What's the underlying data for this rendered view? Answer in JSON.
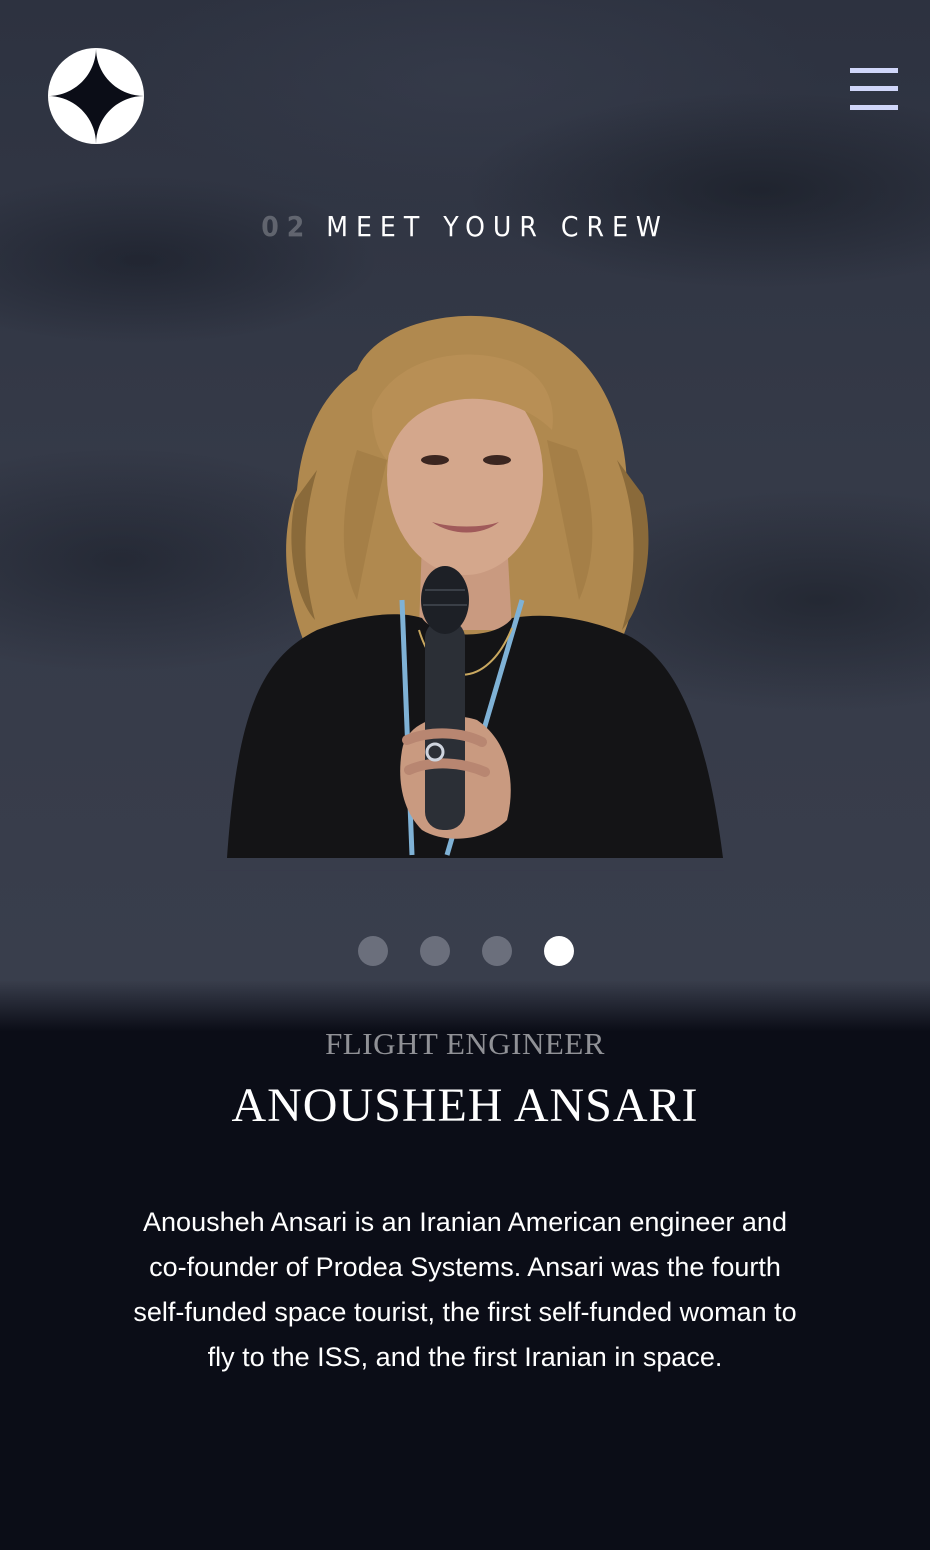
{
  "header": {
    "logo_icon": "four-point-star-icon",
    "menu_icon": "hamburger-menu-icon"
  },
  "page": {
    "number": "02",
    "title": "MEET YOUR CREW"
  },
  "carousel": {
    "total": 4,
    "active_index": 3
  },
  "crew": {
    "role": "FLIGHT ENGINEER",
    "name": "ANOUSHEH ANSARI",
    "bio": "Anousheh Ansari is an Iranian American engineer and co-founder of Prodea Systems. Ansari was the fourth self-funded space tourist, the first self-funded woman to fly to the ISS, and the first Iranian in space."
  },
  "colors": {
    "background": "#0b0d17",
    "accent": "#d0d6f9",
    "text": "#ffffff",
    "dot_inactive": "#6b6f7c",
    "dot_active": "#ffffff"
  }
}
